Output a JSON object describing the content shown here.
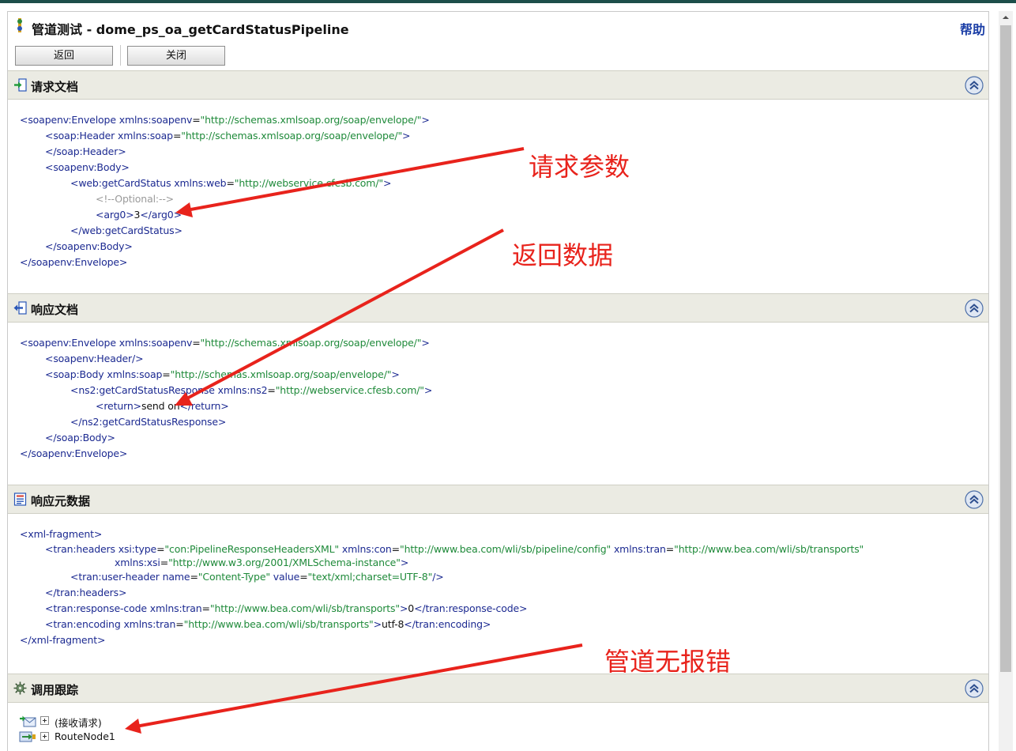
{
  "window": {
    "title": "管道测试 - dome_ps_oa_getCardStatusPipeline",
    "help_label": "帮助"
  },
  "toolbar": {
    "back_label": "返回",
    "close_label": "关闭"
  },
  "sections": {
    "request": {
      "title": "请求文档"
    },
    "response": {
      "title": "响应文档"
    },
    "metadata": {
      "title": "响应元数据"
    },
    "trace": {
      "title": "调用跟踪"
    }
  },
  "request_xml": [
    {
      "indent": 0,
      "parts": [
        [
          "tag",
          "<soapenv:Envelope "
        ],
        [
          "attr",
          "xmlns:soapenv"
        ],
        [
          "txt",
          "="
        ],
        [
          "val",
          "\"http://schemas.xmlsoap.org/soap/envelope/\""
        ],
        [
          "tag",
          ">"
        ]
      ]
    },
    {
      "indent": 1,
      "parts": [
        [
          "tag",
          "<soap:Header "
        ],
        [
          "attr",
          "xmlns:soap"
        ],
        [
          "txt",
          "="
        ],
        [
          "val",
          "\"http://schemas.xmlsoap.org/soap/envelope/\""
        ],
        [
          "tag",
          ">"
        ]
      ]
    },
    {
      "indent": 1,
      "parts": [
        [
          "tag",
          "</soap:Header>"
        ]
      ]
    },
    {
      "indent": 1,
      "parts": [
        [
          "tag",
          "<soapenv:Body>"
        ]
      ]
    },
    {
      "indent": 2,
      "parts": [
        [
          "tag",
          "<web:getCardStatus "
        ],
        [
          "attr",
          "xmlns:web"
        ],
        [
          "txt",
          "="
        ],
        [
          "val",
          "\"http://webservice.cfesb.com/\""
        ],
        [
          "tag",
          ">"
        ]
      ]
    },
    {
      "indent": 3,
      "parts": [
        [
          "cmt",
          "<!--Optional:-->"
        ]
      ]
    },
    {
      "indent": 3,
      "parts": [
        [
          "tag",
          "<arg0>"
        ],
        [
          "txt",
          "3"
        ],
        [
          "tag",
          "</arg0>"
        ]
      ]
    },
    {
      "indent": 2,
      "parts": [
        [
          "tag",
          "</web:getCardStatus>"
        ]
      ]
    },
    {
      "indent": 1,
      "parts": [
        [
          "tag",
          "</soapenv:Body>"
        ]
      ]
    },
    {
      "indent": 0,
      "parts": [
        [
          "tag",
          "</soapenv:Envelope>"
        ]
      ]
    }
  ],
  "response_xml": [
    {
      "indent": 0,
      "parts": [
        [
          "tag",
          "<soapenv:Envelope "
        ],
        [
          "attr",
          "xmlns:soapenv"
        ],
        [
          "txt",
          "="
        ],
        [
          "val",
          "\"http://schemas.xmlsoap.org/soap/envelope/\""
        ],
        [
          "tag",
          ">"
        ]
      ]
    },
    {
      "indent": 1,
      "parts": [
        [
          "tag",
          "<soapenv:Header/>"
        ]
      ]
    },
    {
      "indent": 1,
      "parts": [
        [
          "tag",
          "<soap:Body "
        ],
        [
          "attr",
          "xmlns:soap"
        ],
        [
          "txt",
          "="
        ],
        [
          "val",
          "\"http://schemas.xmlsoap.org/soap/envelope/\""
        ],
        [
          "tag",
          ">"
        ]
      ]
    },
    {
      "indent": 2,
      "parts": [
        [
          "tag",
          "<ns2:getCardStatusResponse "
        ],
        [
          "attr",
          "xmlns:ns2"
        ],
        [
          "txt",
          "="
        ],
        [
          "val",
          "\"http://webservice.cfesb.com/\""
        ],
        [
          "tag",
          ">"
        ]
      ]
    },
    {
      "indent": 3,
      "parts": [
        [
          "tag",
          "<return>"
        ],
        [
          "txt",
          "send on"
        ],
        [
          "tag",
          "</return>"
        ]
      ]
    },
    {
      "indent": 2,
      "parts": [
        [
          "tag",
          "</ns2:getCardStatusResponse>"
        ]
      ]
    },
    {
      "indent": 1,
      "parts": [
        [
          "tag",
          "</soap:Body>"
        ]
      ]
    },
    {
      "indent": 0,
      "parts": [
        [
          "tag",
          "</soapenv:Envelope>"
        ]
      ]
    }
  ],
  "metadata_xml": [
    {
      "indent": 0,
      "parts": [
        [
          "tag",
          "<xml-fragment>"
        ]
      ]
    },
    {
      "indent": 1,
      "short": true,
      "parts": [
        [
          "tag",
          "<tran:headers "
        ],
        [
          "attr",
          "xsi:type"
        ],
        [
          "txt",
          "="
        ],
        [
          "val",
          "\"con:PipelineResponseHeadersXML\""
        ],
        [
          "txt",
          " "
        ],
        [
          "attr",
          "xmlns:con"
        ],
        [
          "txt",
          "="
        ],
        [
          "val",
          "\"http://www.bea.com/wli/sb/pipeline/config\""
        ],
        [
          "txt",
          " "
        ],
        [
          "attr",
          "xmlns:tran"
        ],
        [
          "txt",
          "="
        ],
        [
          "val",
          "\"http://www.bea.com/wli/sb/transports\""
        ]
      ]
    },
    {
      "indent": 1,
      "extra": 88,
      "short": true,
      "parts": [
        [
          "attr",
          "xmlns:xsi"
        ],
        [
          "txt",
          "="
        ],
        [
          "val",
          "\"http://www.w3.org/2001/XMLSchema-instance\""
        ],
        [
          "tag",
          ">"
        ]
      ]
    },
    {
      "indent": 2,
      "parts": [
        [
          "tag",
          "<tran:user-header "
        ],
        [
          "attr",
          "name"
        ],
        [
          "txt",
          "="
        ],
        [
          "val",
          "\"Content-Type\""
        ],
        [
          "txt",
          " "
        ],
        [
          "attr",
          "value"
        ],
        [
          "txt",
          "="
        ],
        [
          "val",
          "\"text/xml;charset=UTF-8\""
        ],
        [
          "tag",
          "/>"
        ]
      ]
    },
    {
      "indent": 1,
      "parts": [
        [
          "tag",
          "</tran:headers>"
        ]
      ]
    },
    {
      "indent": 1,
      "parts": [
        [
          "tag",
          "<tran:response-code "
        ],
        [
          "attr",
          "xmlns:tran"
        ],
        [
          "txt",
          "="
        ],
        [
          "val",
          "\"http://www.bea.com/wli/sb/transports\""
        ],
        [
          "tag",
          ">"
        ],
        [
          "txt",
          "0"
        ],
        [
          "tag",
          "</tran:response-code>"
        ]
      ]
    },
    {
      "indent": 1,
      "parts": [
        [
          "tag",
          "<tran:encoding "
        ],
        [
          "attr",
          "xmlns:tran"
        ],
        [
          "txt",
          "="
        ],
        [
          "val",
          "\"http://www.bea.com/wli/sb/transports\""
        ],
        [
          "tag",
          ">"
        ],
        [
          "txt",
          "utf-8"
        ],
        [
          "tag",
          "</tran:encoding>"
        ]
      ]
    },
    {
      "indent": 0,
      "parts": [
        [
          "tag",
          "</xml-fragment>"
        ]
      ]
    }
  ],
  "trace_items": [
    {
      "label": "(接收请求)",
      "icon": "receive-request-icon"
    },
    {
      "label": "RouteNode1",
      "icon": "route-node-icon"
    }
  ],
  "annotations": {
    "request_params": "请求参数",
    "return_data": "返回数据",
    "no_error": "管道无报错"
  },
  "colors": {
    "tag": "#1c2a91",
    "value": "#1f8a3a",
    "comment": "#9a9a9a",
    "annotation": "#e8231c",
    "section_header": "#ebebe3"
  }
}
